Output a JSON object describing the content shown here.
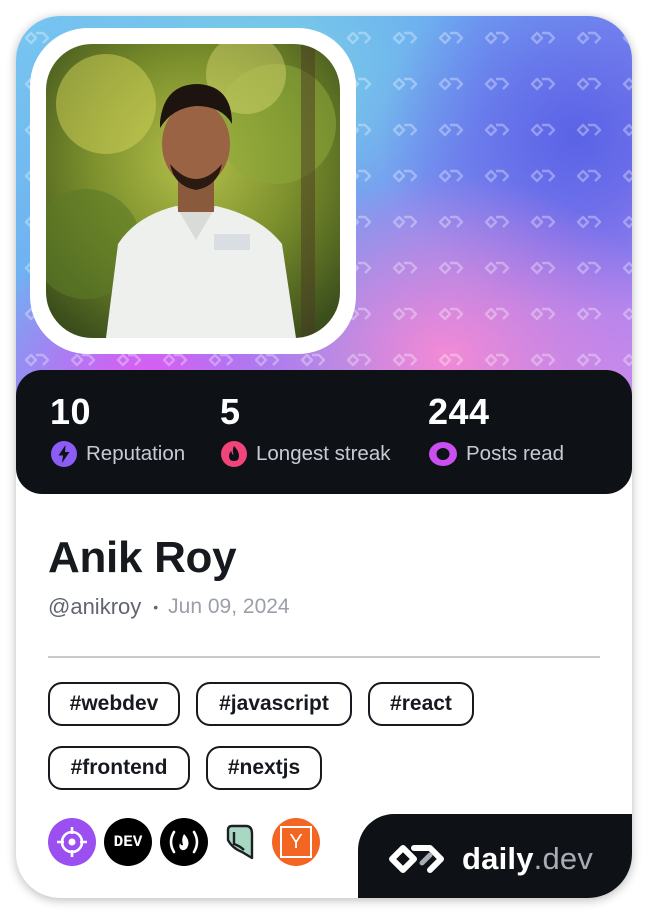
{
  "profile": {
    "name": "Anik Roy",
    "handle": "@anikroy",
    "separator": "•",
    "joined_date": "Jun 09, 2024"
  },
  "stats": [
    {
      "value": "10",
      "label": "Reputation",
      "icon": "lightning-bolt-icon",
      "color": "#8b5cf6"
    },
    {
      "value": "5",
      "label": "Longest streak",
      "icon": "flame-icon",
      "color": "#f0447b"
    },
    {
      "value": "244",
      "label": "Posts read",
      "icon": "eye-icon",
      "color": "#c94ff0"
    }
  ],
  "tags": [
    "#webdev",
    "#javascript",
    "#react",
    "#frontend",
    "#nextjs"
  ],
  "socials": [
    {
      "name": "crosshair-icon",
      "color": "#9b4ff0",
      "text": ""
    },
    {
      "name": "dev-to-icon",
      "color": "#000000",
      "text": "DEV"
    },
    {
      "name": "freecodecamp-icon",
      "color": "#000000",
      "text": "(🔥)"
    },
    {
      "name": "hashnode-icon",
      "color": "#ffffff",
      "text": ""
    },
    {
      "name": "y-combinator-icon",
      "color": "#f26522",
      "text": "Y"
    }
  ],
  "brand": {
    "name": "daily",
    "suffix": ".dev"
  },
  "colors": {
    "card_dark": "#0e1217",
    "text_dark": "#161a1f",
    "muted": "#61666e"
  }
}
